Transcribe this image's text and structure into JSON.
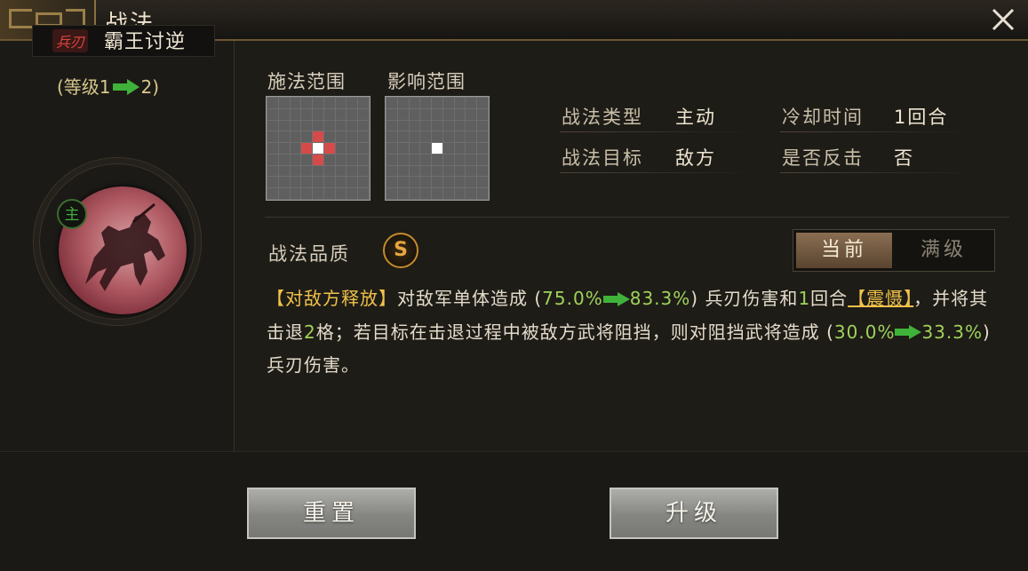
{
  "window": {
    "title": "战法"
  },
  "skill": {
    "type_tag": "兵刃",
    "name": "霸王讨逆",
    "level_open": "(等级1",
    "level_close": "2)",
    "main_badge": "主"
  },
  "range": {
    "cast_label": "施法范围",
    "effect_label": "影响范围"
  },
  "info": {
    "type_label": "战法类型",
    "type_value": "主动",
    "cooldown_label": "冷却时间",
    "cooldown_value": "1回合",
    "target_label": "战法目标",
    "target_value": "敌方",
    "counter_label": "是否反击",
    "counter_value": "否"
  },
  "quality": {
    "label": "战法品质",
    "grade": "S"
  },
  "toggle": {
    "current": "当前",
    "max": "满级"
  },
  "description": {
    "tag": "【对敌方释放】",
    "p1": "对敌军单体造成",
    "open1": "(",
    "dmg1_from": "75.0%",
    "dmg1_to": "83.3%",
    "close1": ")",
    "p2": "兵刃伤害和",
    "rounds": "1",
    "p3": "回合",
    "status": "【震慑】",
    "p4": "，并将其击退",
    "knockback": "2",
    "p5": "格；若目标在击退过程中被敌方武将阻挡，则对阻挡武将造成",
    "open2": "(",
    "dmg2_from": "30.0%",
    "dmg2_to": "33.3%",
    "close2": ")",
    "p6": "兵刃伤害。"
  },
  "buttons": {
    "reset": "重置",
    "upgrade": "升级"
  },
  "colors": {
    "accent_gold": "#f0c24a",
    "accent_green": "#9fd25a",
    "range_red": "#d64a4a"
  }
}
